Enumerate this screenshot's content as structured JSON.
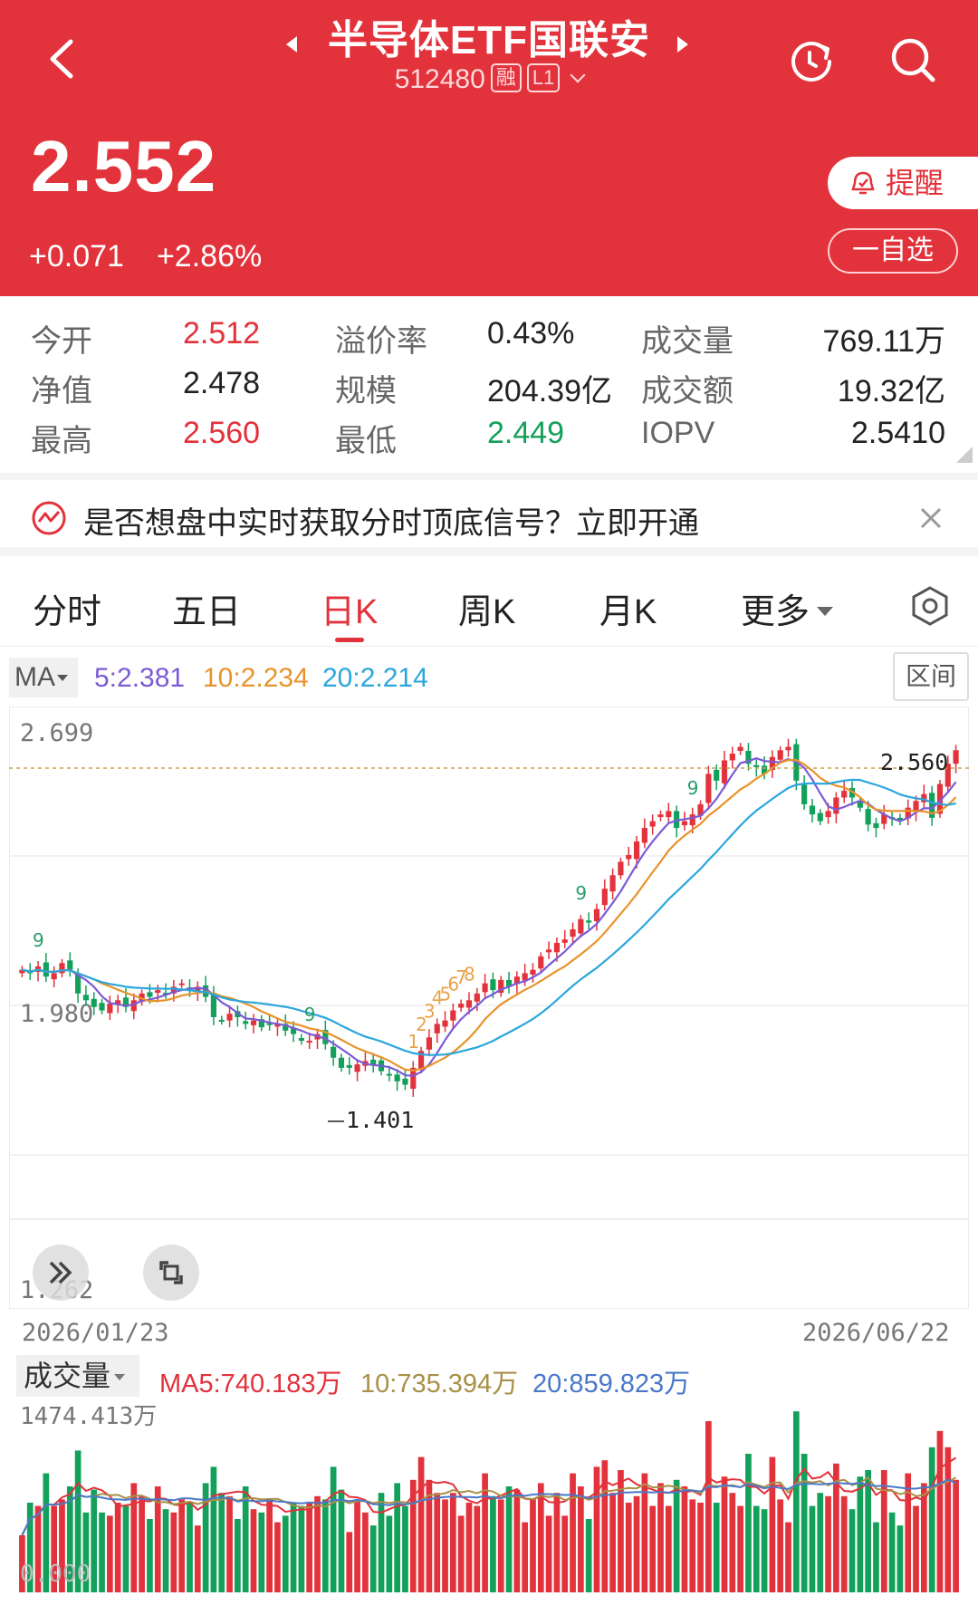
{
  "header": {
    "title": "半导体ETF国联安",
    "code": "512480",
    "tag_margin": "融",
    "tag_level": "L1",
    "price": "2.552",
    "change": "+0.071",
    "change_pct": "+2.86%",
    "remind_label": "提醒",
    "watch_label": "一自选"
  },
  "quote": {
    "open_label": "今开",
    "open": "2.512",
    "premium_label": "溢价率",
    "premium": "0.43%",
    "volume_label": "成交量",
    "volume": "769.11万",
    "nav_label": "净值",
    "nav": "2.478",
    "scale_label": "规模",
    "scale": "204.39亿",
    "amount_label": "成交额",
    "amount": "19.32亿",
    "high_label": "最高",
    "high": "2.560",
    "low_label": "最低",
    "low": "2.449",
    "iopv_label": "IOPV",
    "iopv": "2.5410"
  },
  "banner": {
    "text": "是否想盘中实时获取分时顶底信号？立即开通"
  },
  "tabs": [
    {
      "label": "分时"
    },
    {
      "label": "五日"
    },
    {
      "label": "日K"
    },
    {
      "label": "周K"
    },
    {
      "label": "月K"
    },
    {
      "label": "更多"
    }
  ],
  "active_tab": "日K",
  "ma": {
    "selector": "MA",
    "ma5": "5:2.381",
    "ma10": "10:2.234",
    "ma20": "20:2.214",
    "range_button": "区间"
  },
  "colors": {
    "up": "#e2323b",
    "down": "#13a05a",
    "ma5": "#7c5ad6",
    "ma10": "#e8932a",
    "ma20": "#2aa6dc"
  },
  "chart_data": {
    "type": "candlestick",
    "y_axis_labels": [
      "2.699",
      "1.980",
      "1.262"
    ],
    "x_axis_labels": [
      "2026/01/23",
      "2026/06/22"
    ],
    "ylim": [
      1.262,
      2.699
    ],
    "max_marker": "2.560",
    "min_marker": "1.401",
    "seq_marks": [
      "9",
      "9",
      "9",
      "9",
      "1",
      "2",
      "3",
      "4",
      "5",
      "6",
      "7",
      "8"
    ],
    "closes": [
      2.0,
      1.99,
      2.01,
      1.98,
      1.99,
      2.02,
      2.0,
      1.93,
      1.91,
      1.89,
      1.88,
      1.9,
      1.91,
      1.89,
      1.91,
      1.93,
      1.92,
      1.94,
      1.93,
      1.95,
      1.96,
      1.94,
      1.95,
      1.92,
      1.86,
      1.85,
      1.87,
      1.86,
      1.84,
      1.85,
      1.83,
      1.84,
      1.84,
      1.82,
      1.81,
      1.79,
      1.79,
      1.81,
      1.78,
      1.74,
      1.71,
      1.71,
      1.72,
      1.73,
      1.72,
      1.7,
      1.69,
      1.67,
      1.66,
      1.71,
      1.76,
      1.8,
      1.84,
      1.85,
      1.88,
      1.9,
      1.91,
      1.93,
      1.96,
      1.94,
      1.97,
      1.95,
      1.98,
      1.99,
      2.0,
      2.04,
      2.06,
      2.08,
      2.09,
      2.12,
      2.15,
      2.14,
      2.18,
      2.24,
      2.28,
      2.32,
      2.34,
      2.38,
      2.42,
      2.44,
      2.46,
      2.47,
      2.42,
      2.44,
      2.46,
      2.49,
      2.58,
      2.56,
      2.62,
      2.64,
      2.66,
      2.61,
      2.6,
      2.58,
      2.63,
      2.65,
      2.66,
      2.56,
      2.49,
      2.46,
      2.44,
      2.47,
      2.51,
      2.53,
      2.51,
      2.48,
      2.43,
      2.42,
      2.46,
      2.45,
      2.44,
      2.48,
      2.5,
      2.52,
      2.45,
      2.55,
      2.61,
      2.65
    ],
    "volume_axis": {
      "max_label": "1474.413万",
      "min_label": "0.000"
    }
  },
  "volume": {
    "selector": "成交量",
    "ma5": "MA5:740.183万",
    "ma10": "10:735.394万",
    "ma20": "20:859.823万"
  }
}
